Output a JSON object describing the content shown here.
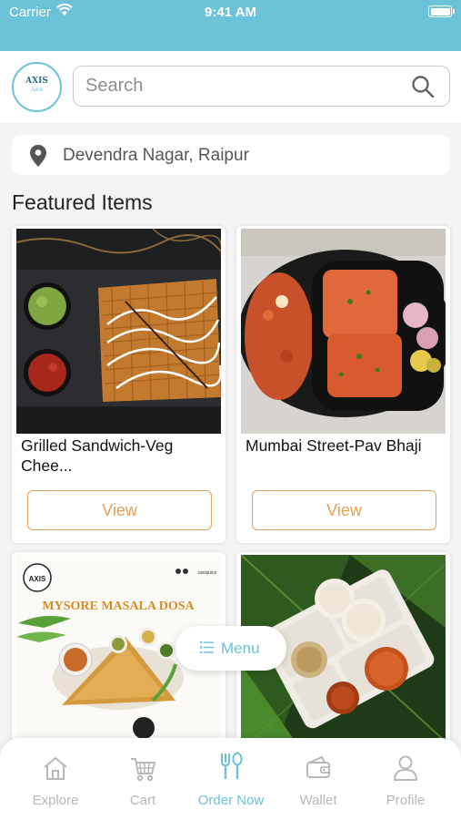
{
  "status_bar": {
    "carrier": "Carrier",
    "time": "9:41 AM"
  },
  "header": {
    "logo_text": "AXIS",
    "logo_subtext": "Juice",
    "search_placeholder": "Search"
  },
  "location": {
    "text": "Devendra Nagar, Raipur"
  },
  "featured": {
    "title": "Featured Items",
    "items": [
      {
        "name": "Grilled Sandwich-Veg Chee...",
        "button": "View"
      },
      {
        "name": "Mumbai Street-Pav Bhaji",
        "button": "View"
      },
      {
        "name": "",
        "promo_title": "MYSORE MASALA DOSA"
      },
      {
        "name": ""
      }
    ]
  },
  "menu_button": {
    "label": "Menu",
    "icon": "list-icon"
  },
  "tab_bar": {
    "items": [
      {
        "label": "Explore",
        "icon": "home-icon",
        "active": false
      },
      {
        "label": "Cart",
        "icon": "cart-icon",
        "active": false
      },
      {
        "label": "Order Now",
        "icon": "fork-spoon-icon",
        "active": true
      },
      {
        "label": "Wallet",
        "icon": "wallet-icon",
        "active": false
      },
      {
        "label": "Profile",
        "icon": "profile-icon",
        "active": false
      }
    ]
  },
  "colors": {
    "accent": "#6cc2d8",
    "button_outline": "#e3a15a",
    "inactive_tab": "#b8b8b8"
  }
}
